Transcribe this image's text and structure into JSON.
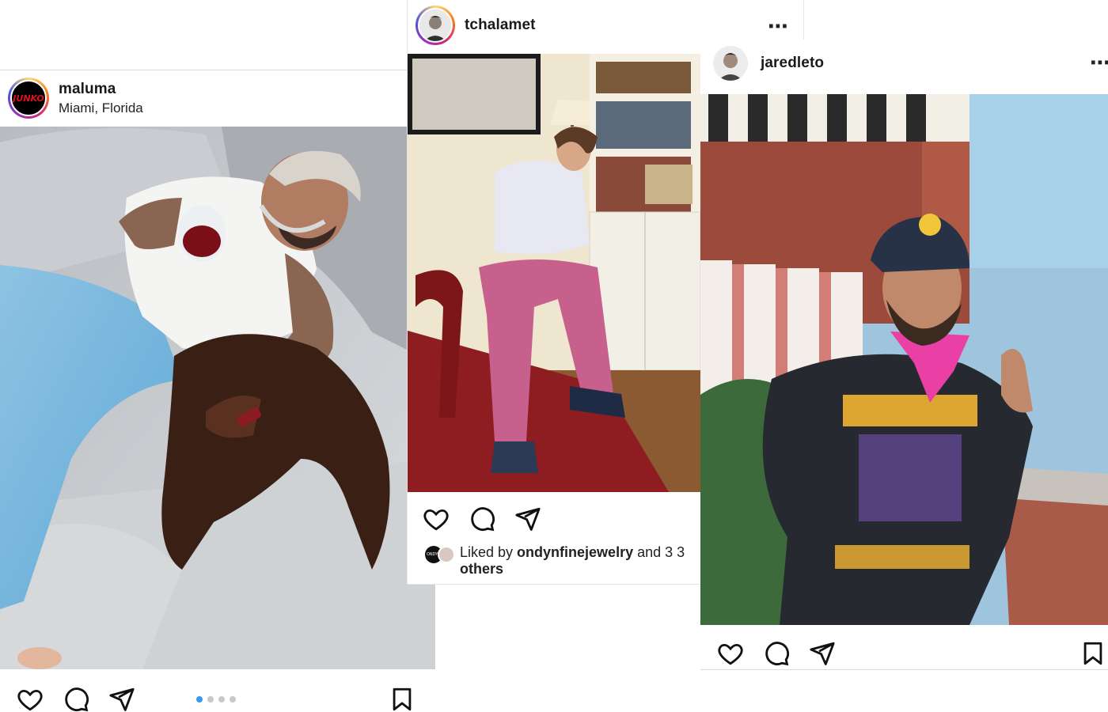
{
  "posts": [
    {
      "username": "maluma",
      "location": "Miami, Florida",
      "avatar_text": "JUNKO",
      "avatar_colors": {
        "bg": "#000000",
        "text": "#e0101e"
      },
      "carousel": {
        "count": 4,
        "active": 1
      }
    },
    {
      "username": "tchalamet",
      "liked_by_prefix": "Liked by ",
      "liked_by_user": "ondynfinejewelry",
      "liked_by_suffix": " and 3 3",
      "liked_by_line2": "others",
      "liked_avatar_text": "ONDYN"
    },
    {
      "username": "jaredleto"
    }
  ],
  "icons": [
    "heart-icon",
    "comment-icon",
    "share-icon",
    "bookmark-icon",
    "more-icon"
  ],
  "colors": {
    "accent": "#3897f0",
    "divider": "#dbdbdb",
    "text": "#111111"
  }
}
